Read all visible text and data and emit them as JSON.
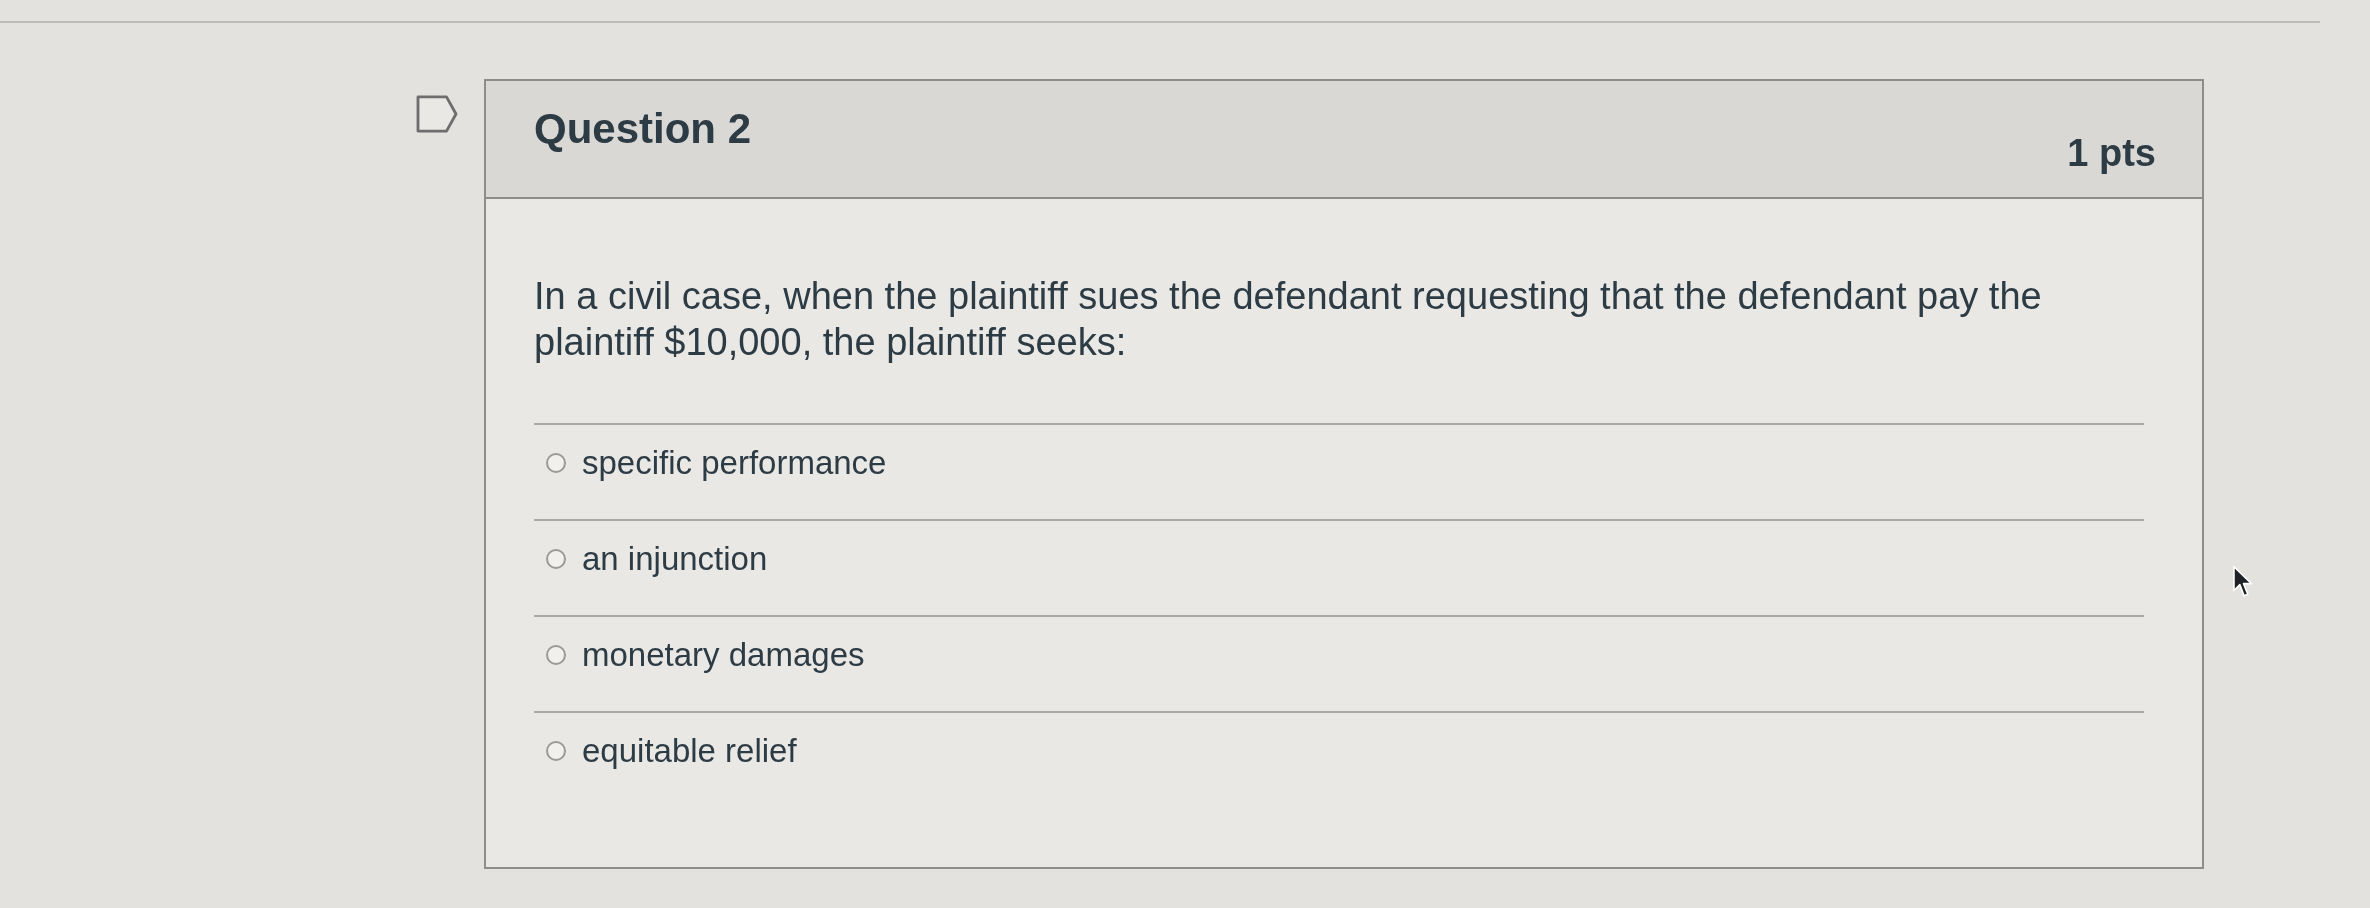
{
  "question": {
    "title": "Question 2",
    "points": "1 pts",
    "text": "In a civil case, when the plaintiff sues the defendant requesting that the defendant pay the plaintiff $10,000, the plaintiff seeks:",
    "answers": [
      {
        "label": "specific performance",
        "selected": false
      },
      {
        "label": "an injunction",
        "selected": false
      },
      {
        "label": "monetary damages",
        "selected": false
      },
      {
        "label": "equitable relief",
        "selected": false
      }
    ]
  }
}
